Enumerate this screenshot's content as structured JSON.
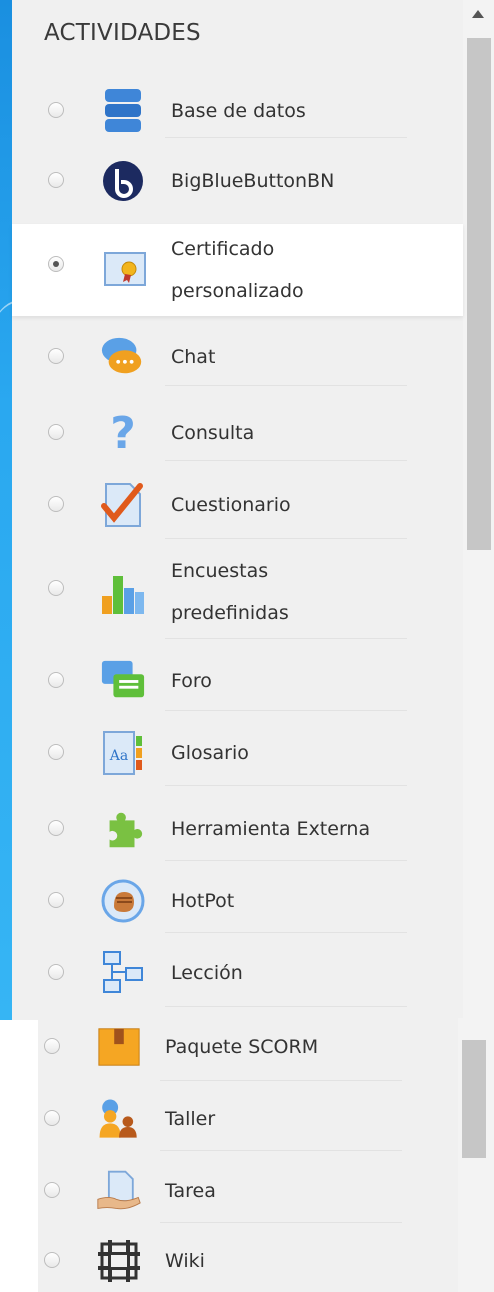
{
  "section_title": "ACTIVIDADES",
  "items": [
    {
      "label": "Base de datos",
      "icon": "database-icon",
      "selected": false
    },
    {
      "label": "BigBlueButtonBN",
      "icon": "bigbluebutton-icon",
      "selected": false
    },
    {
      "label_line1": "Certificado",
      "label_line2": "personalizado",
      "icon": "certificate-icon",
      "selected": true
    },
    {
      "label": "Chat",
      "icon": "chat-icon",
      "selected": false
    },
    {
      "label": "Consulta",
      "icon": "question-icon",
      "selected": false
    },
    {
      "label": "Cuestionario",
      "icon": "quiz-icon",
      "selected": false
    },
    {
      "label_line1": "Encuestas",
      "label_line2": "predefinidas",
      "icon": "bar-chart-icon",
      "selected": false
    },
    {
      "label": "Foro",
      "icon": "forum-icon",
      "selected": false
    },
    {
      "label": "Glosario",
      "icon": "glossary-icon",
      "selected": false
    },
    {
      "label": "Herramienta Externa",
      "icon": "puzzle-icon",
      "selected": false
    },
    {
      "label": "HotPot",
      "icon": "hotpot-icon",
      "selected": false
    },
    {
      "label": "Lección",
      "icon": "lesson-icon",
      "selected": false
    },
    {
      "label": "Paquete SCORM",
      "icon": "scorm-package-icon",
      "selected": false
    },
    {
      "label": "Taller",
      "icon": "workshop-icon",
      "selected": false
    },
    {
      "label": "Tarea",
      "icon": "assignment-icon",
      "selected": false
    },
    {
      "label": "Wiki",
      "icon": "wiki-icon",
      "selected": false
    }
  ]
}
